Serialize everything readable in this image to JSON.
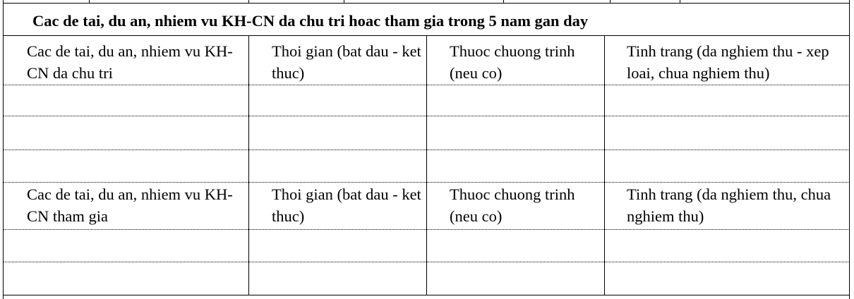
{
  "table": {
    "title": "Cac de tai, du an, nhiem vu KH-CN da chu tri hoac tham gia trong 5 nam gan day",
    "section1": {
      "headers": [
        "Cac de tai, du an, nhiem vu KH-CN da chu tri",
        "Thoi gian (bat dau - ket thuc)",
        "Thuoc chuong trinh (neu co)",
        "Tinh trang (da nghiem thu - xep loai, chua nghiem thu)"
      ]
    },
    "section2": {
      "headers": [
        "Cac de tai, du an, nhiem vu KH-CN tham gia",
        "Thoi gian (bat dau - ket thuc)",
        "Thuoc chuong trinh (neu co)",
        "Tinh trang (da nghiem thu, chua nghiem thu)"
      ]
    }
  }
}
